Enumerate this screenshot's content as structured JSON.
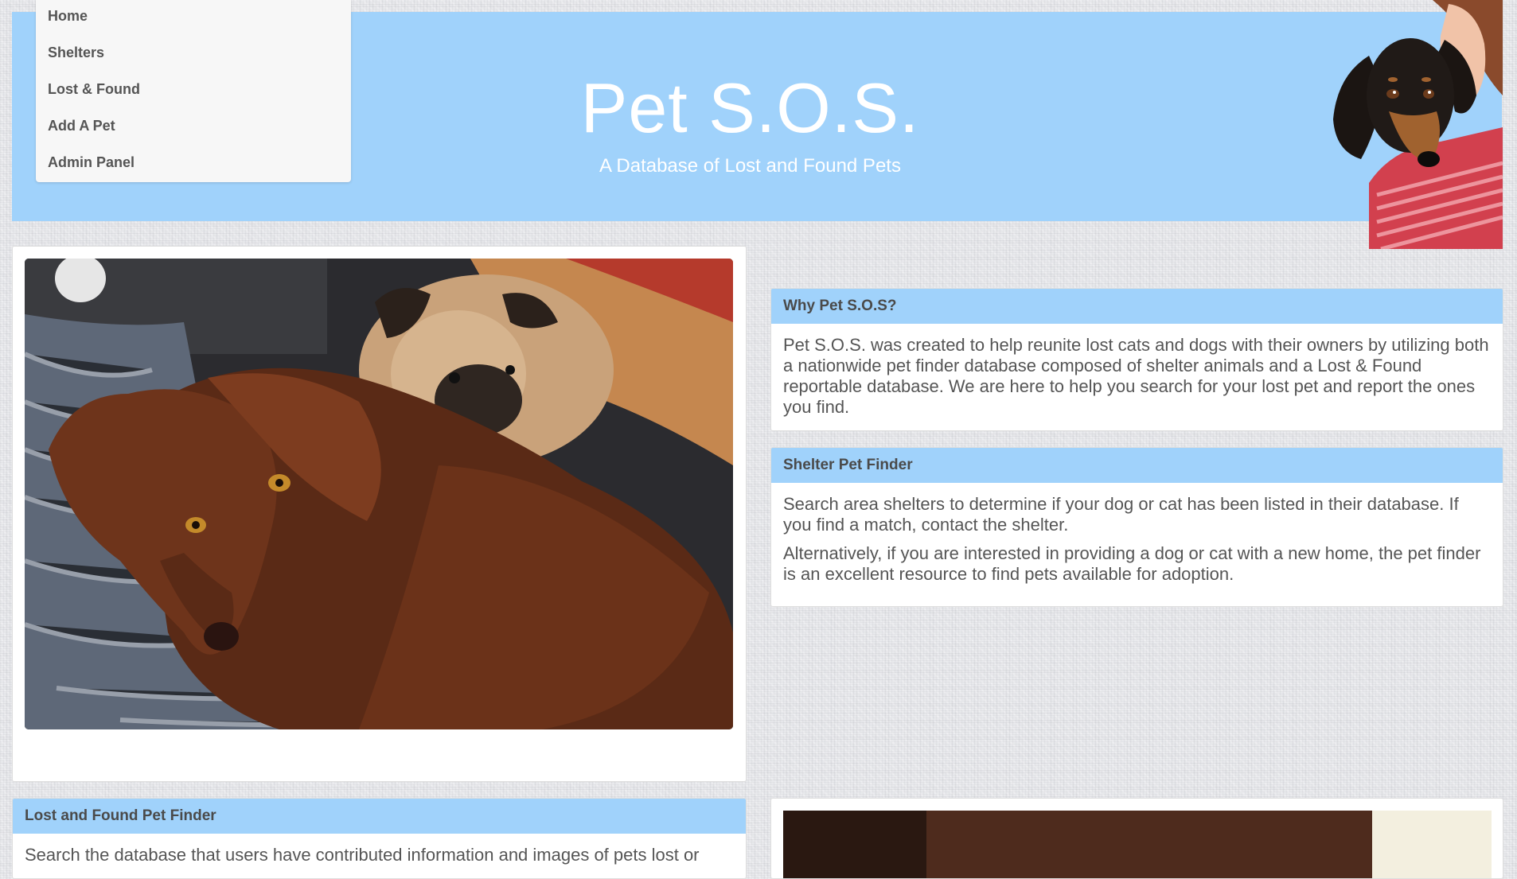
{
  "header": {
    "title": "Pet S.O.S.",
    "subtitle": "A Database of Lost and Found Pets"
  },
  "nav": {
    "items": [
      {
        "label": "Home"
      },
      {
        "label": "Shelters"
      },
      {
        "label": "Lost & Found"
      },
      {
        "label": "Add A Pet"
      },
      {
        "label": "Admin Panel"
      }
    ]
  },
  "panels": {
    "why": {
      "heading": "Why Pet S.O.S?",
      "body": "Pet S.O.S. was created to help reunite lost cats and dogs with their owners by utilizing both a nationwide pet finder database composed of shelter animals and a Lost & Found reportable database. We are here to help you search for your lost pet and report the ones you find."
    },
    "shelter": {
      "heading": "Shelter Pet Finder",
      "body1": "Search area shelters to determine if your dog or cat has been listed in their database. If you find a match, contact the shelter.",
      "body2": "Alternatively, if you are interested in providing a dog or cat with a new home, the pet finder is an excellent resource to find pets available for adoption."
    },
    "lostfound": {
      "heading": "Lost and Found Pet Finder",
      "body": "Search the database that users have contributed information and images of pets lost or"
    }
  },
  "colors": {
    "accent": "#a0d2fb",
    "background": "#e9eaed",
    "text": "#555555"
  }
}
